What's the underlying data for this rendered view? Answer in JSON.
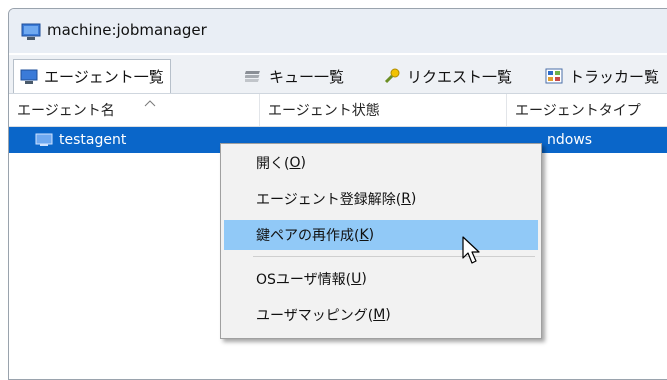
{
  "window": {
    "title": "machine:jobmanager"
  },
  "tabs": [
    {
      "label": "エージェント一覧",
      "icon": "monitor-icon"
    },
    {
      "label": "キュー一覧",
      "icon": "queue-icon"
    },
    {
      "label": "リクエスト一覧",
      "icon": "request-icon"
    },
    {
      "label": "トラッカー覧",
      "icon": "tracker-icon"
    }
  ],
  "columns": [
    {
      "label": "エージェント名"
    },
    {
      "label": "エージェント状態"
    },
    {
      "label": "エージェントタイプ"
    }
  ],
  "rows": [
    {
      "name": "testagent",
      "status": "",
      "type": "ndows"
    }
  ],
  "context_menu": {
    "items": [
      {
        "prefix": "開く(",
        "key": "O",
        "suffix": ")"
      },
      {
        "prefix": "エージェント登録解除(",
        "key": "R",
        "suffix": ")"
      },
      {
        "prefix": "鍵ペアの再作成(",
        "key": "K",
        "suffix": ")",
        "highlighted": true
      },
      {
        "prefix": "OSユーザ情報(",
        "key": "U",
        "suffix": ")"
      },
      {
        "prefix": "ユーザマッピング(",
        "key": "M",
        "suffix": ")"
      }
    ]
  },
  "colors": {
    "selection": "#0a66c9",
    "menu_highlight": "#91c9f7"
  }
}
